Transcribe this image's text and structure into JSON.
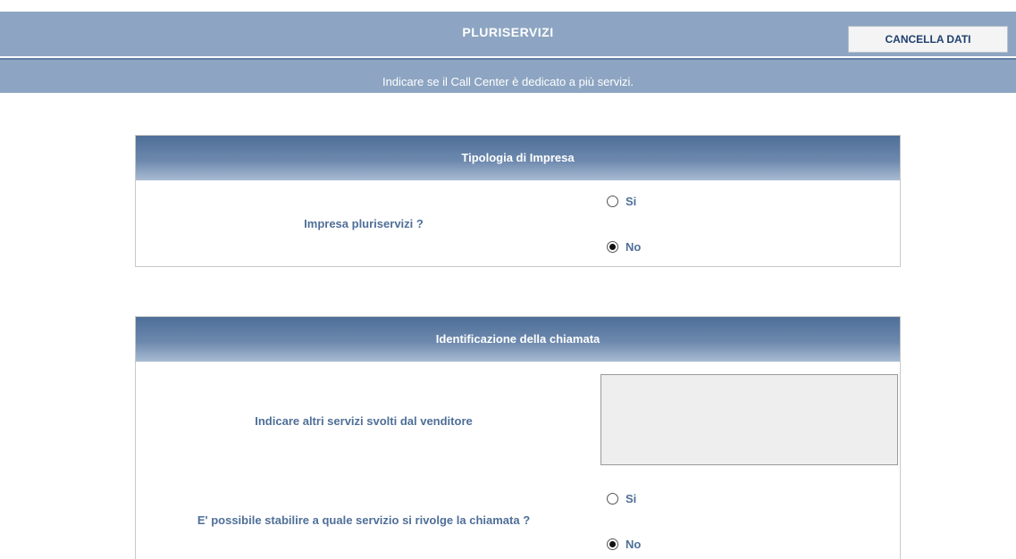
{
  "header": {
    "title": "PLURISERVIZI",
    "subtitle": "Indicare se il Call Center è dedicato a più servizi.",
    "clear_button": "CANCELLA DATI"
  },
  "sections": [
    {
      "title": "Tipologia di Impresa",
      "question": "Impresa pluriservizi ?",
      "options": [
        {
          "label": "Si",
          "selected": false
        },
        {
          "label": "No",
          "selected": true
        }
      ]
    },
    {
      "title": "Identificazione della chiamata",
      "text_question": "Indicare altri servizi svolti dal venditore",
      "text_value": "",
      "question": "E' possibile stabilire a quale servizio si rivolge la chiamata ?",
      "options": [
        {
          "label": "Si",
          "selected": false
        },
        {
          "label": "No",
          "selected": true
        }
      ]
    }
  ],
  "colors": {
    "header_band": "#8da5c2",
    "panel_header": "#5a7aa3",
    "label_text": "#4f6f98",
    "textarea_bg": "#eeeeee"
  }
}
